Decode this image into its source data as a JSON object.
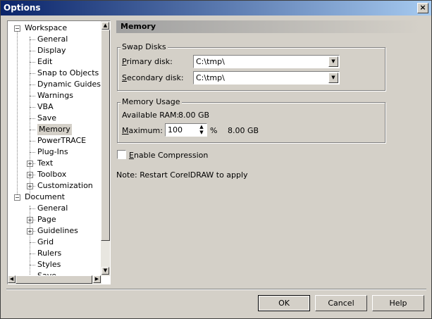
{
  "window": {
    "title": "Options",
    "close_glyph": "×"
  },
  "tree": {
    "nodes": [
      {
        "label": "Workspace",
        "expander": "−"
      },
      {
        "label": "General"
      },
      {
        "label": "Display"
      },
      {
        "label": "Edit"
      },
      {
        "label": "Snap to Objects"
      },
      {
        "label": "Dynamic Guides"
      },
      {
        "label": "Warnings"
      },
      {
        "label": "VBA"
      },
      {
        "label": "Save"
      },
      {
        "label": "Memory",
        "selected": true
      },
      {
        "label": "PowerTRACE"
      },
      {
        "label": "Plug-Ins"
      },
      {
        "label": "Text",
        "expander": "+"
      },
      {
        "label": "Toolbox",
        "expander": "+"
      },
      {
        "label": "Customization",
        "expander": "+"
      },
      {
        "label": "Document",
        "expander": "−"
      },
      {
        "label": "General"
      },
      {
        "label": "Page",
        "expander": "+"
      },
      {
        "label": "Guidelines",
        "expander": "+"
      },
      {
        "label": "Grid"
      },
      {
        "label": "Rulers"
      },
      {
        "label": "Styles"
      },
      {
        "label": "Save"
      }
    ]
  },
  "panel": {
    "title": "Memory",
    "swap": {
      "label": "Swap Disks",
      "primary_label_u": "P",
      "primary_label_rest": "rimary disk:",
      "primary_value": "C:\\tmp\\",
      "secondary_label_u": "S",
      "secondary_label_rest": "econdary disk:",
      "secondary_value": "C:\\tmp\\"
    },
    "usage": {
      "label": "Memory Usage",
      "available_label": "Available RAM:",
      "available_value": "8.00 GB",
      "maximum_label_u": "M",
      "maximum_label_rest": "aximum:",
      "maximum_value": "100",
      "percent_sign": "%",
      "maximum_size": "8.00 GB"
    },
    "compression": {
      "label_u": "E",
      "label_rest": "nable Compression",
      "checked": false
    },
    "note": "Note: Restart CorelDRAW to apply"
  },
  "buttons": {
    "ok": "OK",
    "cancel": "Cancel",
    "help": "Help"
  }
}
